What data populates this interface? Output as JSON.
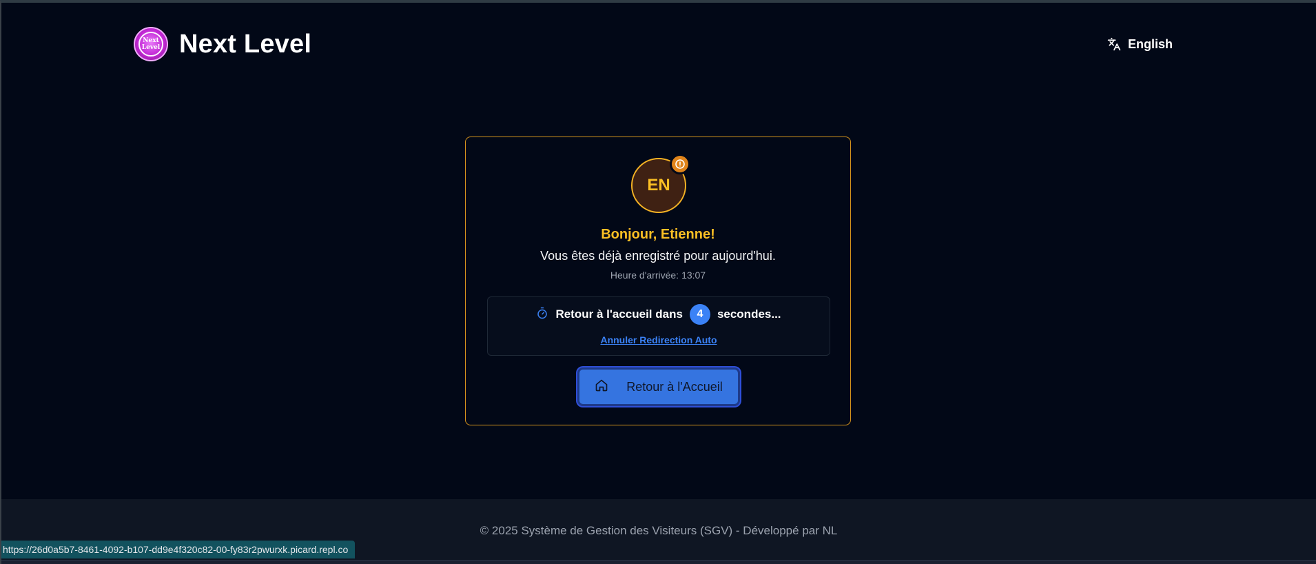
{
  "header": {
    "brand_title": "Next Level",
    "logo_line1": "Next",
    "logo_line2": "Level",
    "language_label": "English"
  },
  "card": {
    "avatar_initials": "EN",
    "greeting": "Bonjour, Etienne!",
    "message": "Vous êtes déjà enregistré pour aujourd'hui.",
    "arrival_label": "Heure d'arrivée:",
    "arrival_time": "13:07",
    "countdown_prefix": "Retour à l'accueil dans",
    "countdown_value": "4",
    "countdown_suffix": "secondes...",
    "cancel_link": "Annuler Redirection Auto",
    "home_button": "Retour à l'Accueil"
  },
  "footer": {
    "text": "© 2025 Système de Gestion des Visiteurs (SGV) - Développé par NL"
  },
  "status_bar": {
    "url": "https://26d0a5b7-8461-4092-b107-dd9e4f320c82-00-fy83r2pwurxk.picard.repl.co"
  },
  "colors": {
    "background": "#020817",
    "accent_amber": "#fbbf24",
    "card_border": "#d6951c",
    "primary_blue": "#3b82f6",
    "footer_bg": "#0f1623"
  },
  "icons": {
    "language": "translate-icon",
    "alert": "alert-circle-icon",
    "timer": "timer-icon",
    "home": "home-icon"
  }
}
